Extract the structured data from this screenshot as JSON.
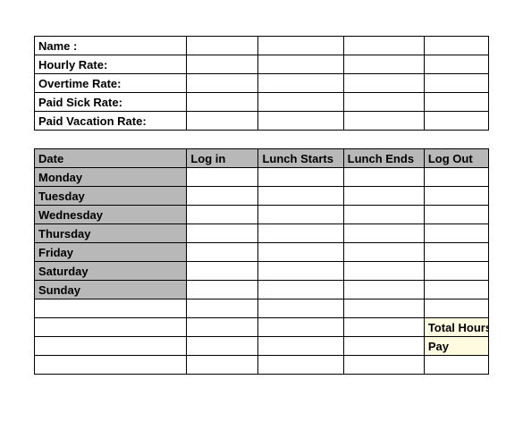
{
  "info": {
    "name_label": "Name :",
    "hourly_rate_label": "Hourly Rate:",
    "overtime_rate_label": "Overtime Rate:",
    "paid_sick_rate_label": "Paid Sick Rate:",
    "paid_vacation_rate_label": "Paid Vacation Rate:"
  },
  "headers": {
    "date": "Date",
    "login": "Log in",
    "lunch_start": "Lunch Starts",
    "lunch_end": "Lunch Ends",
    "logout": "Log Out"
  },
  "days": {
    "mon": "Monday",
    "tue": "Tuesday",
    "wed": "Wednesday",
    "thu": "Thursday",
    "fri": "Friday",
    "sat": "Saturday",
    "sun": "Sunday"
  },
  "summary": {
    "total_hours": "Total Hours",
    "pay": "Pay"
  }
}
